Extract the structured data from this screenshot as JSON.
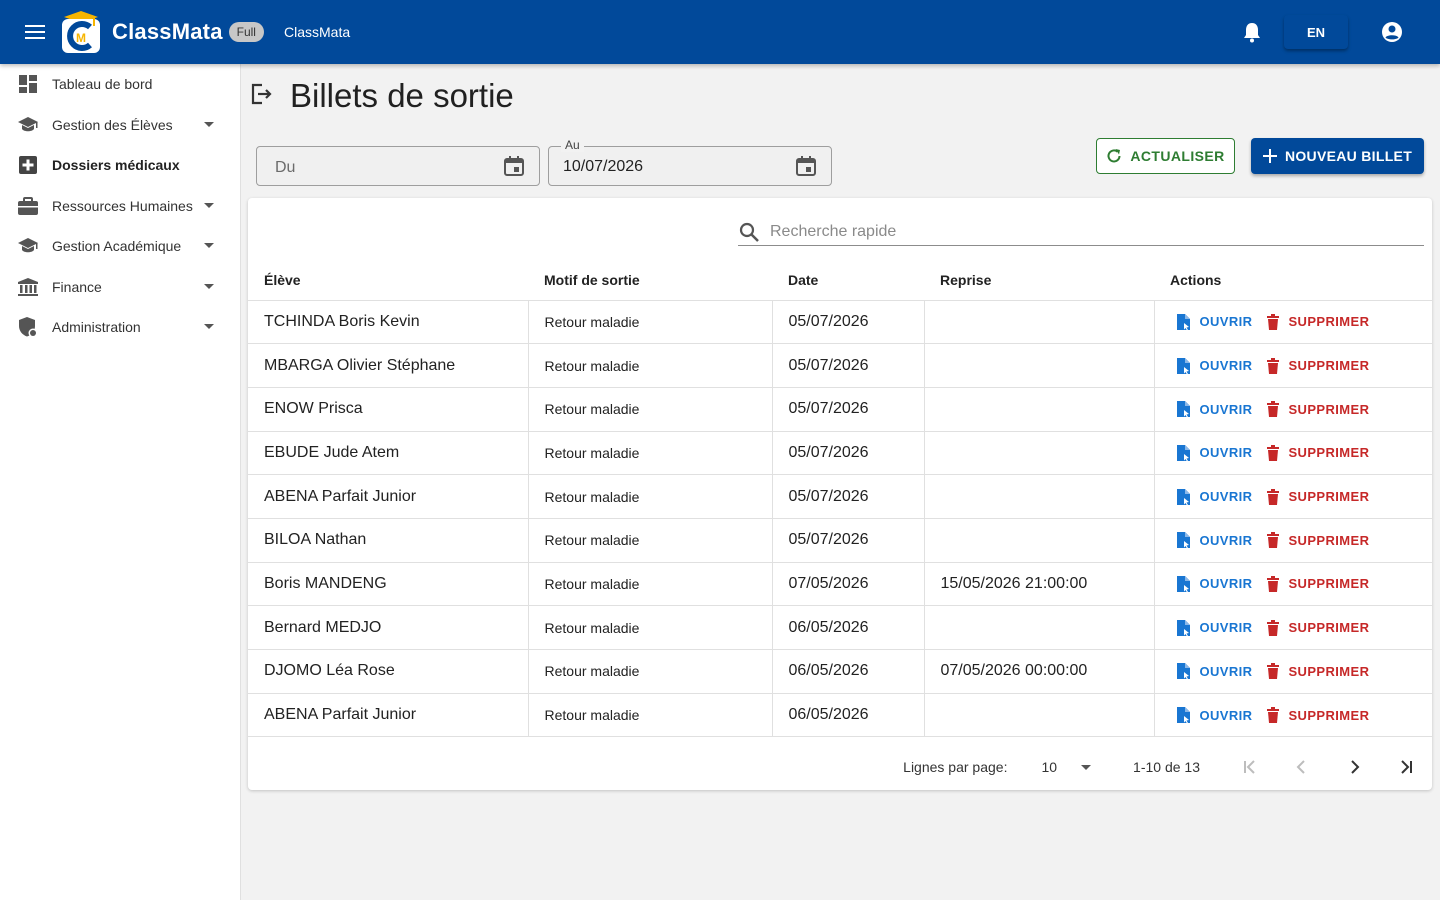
{
  "header": {
    "brand": "ClassMata",
    "plan_badge": "Full",
    "app_name": "ClassMata",
    "language": "EN",
    "colors": {
      "primary": "#01499a",
      "logo_accent": "#f7b500"
    }
  },
  "sidebar": {
    "items": [
      {
        "label": "Tableau de bord",
        "icon": "dashboard-icon"
      },
      {
        "label": "Gestion des Élèves",
        "icon": "school-icon"
      },
      {
        "label": "Dossiers médicaux",
        "icon": "medical-icon"
      },
      {
        "label": "Ressources Humaines",
        "icon": "briefcase-icon"
      },
      {
        "label": "Gestion Académique",
        "icon": "school-icon"
      },
      {
        "label": "Finance",
        "icon": "bank-icon"
      },
      {
        "label": "Administration",
        "icon": "admin-shield-icon"
      }
    ]
  },
  "page": {
    "title": "Billets de sortie",
    "icon": "logout-icon"
  },
  "filters": {
    "from_placeholder": "Du",
    "to_label": "Au",
    "to_value": "10/07/2026"
  },
  "buttons": {
    "refresh": "ACTUALISER",
    "new": "NOUVEAU BILLET"
  },
  "search": {
    "placeholder": "Recherche rapide"
  },
  "table": {
    "columns": [
      "Élève",
      "Motif de sortie",
      "Date",
      "Reprise",
      "Actions"
    ],
    "open_label": "OUVRIR",
    "delete_label": "SUPPRIMER",
    "rows": [
      {
        "eleve": "TCHINDA Boris Kevin",
        "motif": "Retour maladie",
        "date": "05/07/2026",
        "reprise": ""
      },
      {
        "eleve": "MBARGA Olivier Stéphane",
        "motif": "Retour maladie",
        "date": "05/07/2026",
        "reprise": ""
      },
      {
        "eleve": "ENOW Prisca",
        "motif": "Retour maladie",
        "date": "05/07/2026",
        "reprise": ""
      },
      {
        "eleve": "EBUDE Jude Atem",
        "motif": "Retour maladie",
        "date": "05/07/2026",
        "reprise": ""
      },
      {
        "eleve": "ABENA Parfait Junior",
        "motif": "Retour maladie",
        "date": "05/07/2026",
        "reprise": ""
      },
      {
        "eleve": "BILOA Nathan",
        "motif": "Retour maladie",
        "date": "05/07/2026",
        "reprise": ""
      },
      {
        "eleve": "Boris MANDENG",
        "motif": "Retour maladie",
        "date": "07/05/2026",
        "reprise": "15/05/2026 21:00:00"
      },
      {
        "eleve": "Bernard MEDJO",
        "motif": "Retour maladie",
        "date": "06/05/2026",
        "reprise": ""
      },
      {
        "eleve": "DJOMO Léa Rose",
        "motif": "Retour maladie",
        "date": "06/05/2026",
        "reprise": "07/05/2026 00:00:00"
      },
      {
        "eleve": "ABENA Parfait Junior",
        "motif": "Retour maladie",
        "date": "06/05/2026",
        "reprise": ""
      }
    ]
  },
  "pagination": {
    "rows_per_page_label": "Lignes par page:",
    "rows_per_page": "10",
    "range": "1-10 de 13"
  }
}
